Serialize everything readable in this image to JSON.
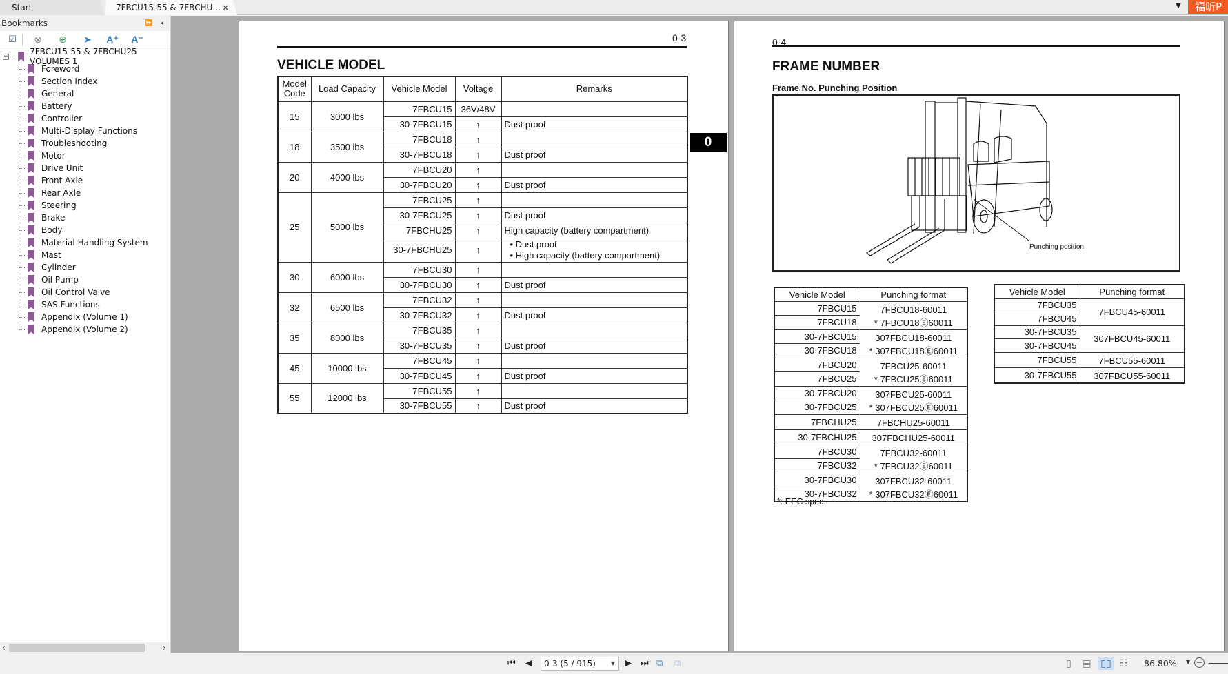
{
  "tabs": [
    {
      "label": "Start"
    },
    {
      "label": "7FBCU15-55 & 7FBCHU...",
      "close": "×"
    }
  ],
  "brand_button": "福昕P",
  "sidebar": {
    "title": "Bookmarks",
    "header_buttons": [
      "⏩",
      "◂"
    ],
    "toolbar": [
      {
        "name": "expand-bookmark",
        "glyph": "☑"
      },
      {
        "name": "delete-bookmark",
        "glyph": "⊗"
      },
      {
        "name": "add-bookmark",
        "glyph": "⊕"
      },
      {
        "name": "goto-bookmark",
        "glyph": "➤"
      },
      {
        "name": "increase-font",
        "glyph": "A⁺"
      },
      {
        "name": "decrease-font",
        "glyph": "A⁻"
      }
    ],
    "root": {
      "label": "7FBCU15-55 & 7FBCHU25 VOLUMES 1",
      "expander": "−"
    },
    "items": [
      "Foreword",
      "Section Index",
      "General",
      "Battery",
      "Controller",
      "Multi-Display Functions",
      "Troubleshooting",
      "Motor",
      "Drive Unit",
      "Front Axle",
      "Rear Axle",
      "Steering",
      "Brake",
      "Body",
      "Material Handling System",
      "Mast",
      "Cylinder",
      "Oil Pump",
      "Oil Control Valve",
      "SAS Functions",
      "Appendix (Volume 1)",
      "Appendix (Volume 2)"
    ],
    "scroll_left": "‹",
    "scroll_right": "›"
  },
  "left_page": {
    "page_number": "0-3",
    "title": "VEHICLE MODEL",
    "section_tab": "0",
    "table": {
      "headers": [
        "Model Code",
        "Load Capacity",
        "Vehicle Model",
        "Voltage",
        "Remarks"
      ],
      "groups": [
        {
          "code": "15",
          "load": "3000 lbs",
          "rows": [
            {
              "model": "7FBCU15",
              "voltage": "36V/48V",
              "remarks": []
            },
            {
              "model": "30-7FBCU15",
              "voltage": "↑",
              "remarks": [
                "Dust proof"
              ]
            }
          ]
        },
        {
          "code": "18",
          "load": "3500 lbs",
          "rows": [
            {
              "model": "7FBCU18",
              "voltage": "↑",
              "remarks": []
            },
            {
              "model": "30-7FBCU18",
              "voltage": "↑",
              "remarks": [
                "Dust proof"
              ]
            }
          ]
        },
        {
          "code": "20",
          "load": "4000 lbs",
          "rows": [
            {
              "model": "7FBCU20",
              "voltage": "↑",
              "remarks": []
            },
            {
              "model": "30-7FBCU20",
              "voltage": "↑",
              "remarks": [
                "Dust proof"
              ]
            }
          ]
        },
        {
          "code": "25",
          "load": "5000 lbs",
          "rows": [
            {
              "model": "7FBCU25",
              "voltage": "↑",
              "remarks": []
            },
            {
              "model": "30-7FBCU25",
              "voltage": "↑",
              "remarks": [
                "Dust proof"
              ]
            },
            {
              "model": "7FBCHU25",
              "voltage": "↑",
              "remarks": [
                "High capacity (battery compartment)"
              ]
            },
            {
              "model": "30-7FBCHU25",
              "voltage": "↑",
              "remarks": [
                "Dust proof",
                "High capacity (battery compartment)"
              ],
              "bulleted": true
            }
          ]
        },
        {
          "code": "30",
          "load": "6000 lbs",
          "rows": [
            {
              "model": "7FBCU30",
              "voltage": "↑",
              "remarks": []
            },
            {
              "model": "30-7FBCU30",
              "voltage": "↑",
              "remarks": [
                "Dust proof"
              ]
            }
          ]
        },
        {
          "code": "32",
          "load": "6500 lbs",
          "rows": [
            {
              "model": "7FBCU32",
              "voltage": "↑",
              "remarks": []
            },
            {
              "model": "30-7FBCU32",
              "voltage": "↑",
              "remarks": [
                "Dust proof"
              ]
            }
          ]
        },
        {
          "code": "35",
          "load": "8000 lbs",
          "rows": [
            {
              "model": "7FBCU35",
              "voltage": "↑",
              "remarks": []
            },
            {
              "model": "30-7FBCU35",
              "voltage": "↑",
              "remarks": [
                "Dust proof"
              ]
            }
          ]
        },
        {
          "code": "45",
          "load": "10000 lbs",
          "rows": [
            {
              "model": "7FBCU45",
              "voltage": "↑",
              "remarks": []
            },
            {
              "model": "30-7FBCU45",
              "voltage": "↑",
              "remarks": [
                "Dust proof"
              ]
            }
          ]
        },
        {
          "code": "55",
          "load": "12000 lbs",
          "rows": [
            {
              "model": "7FBCU55",
              "voltage": "↑",
              "remarks": []
            },
            {
              "model": "30-7FBCU55",
              "voltage": "↑",
              "remarks": [
                "Dust proof"
              ]
            }
          ]
        }
      ]
    }
  },
  "right_page": {
    "page_number": "0-4",
    "title": "FRAME NUMBER",
    "subtitle": "Frame No. Punching Position",
    "figure_label": "Punching position",
    "table1": {
      "headers": [
        "Vehicle Model",
        "Punching format"
      ],
      "groups": [
        {
          "models": [
            "7FBCU15",
            "7FBCU18"
          ],
          "formats": [
            "7FBCU18-60011",
            "* 7FBCU18Ⓔ60011"
          ]
        },
        {
          "models": [
            "30-7FBCU15",
            "30-7FBCU18"
          ],
          "formats": [
            "307FBCU18-60011",
            "* 307FBCU18Ⓔ60011"
          ]
        },
        {
          "models": [
            "7FBCU20",
            "7FBCU25"
          ],
          "formats": [
            "7FBCU25-60011",
            "* 7FBCU25Ⓔ60011"
          ]
        },
        {
          "models": [
            "30-7FBCU20",
            "30-7FBCU25"
          ],
          "formats": [
            "307FBCU25-60011",
            "* 307FBCU25Ⓔ60011"
          ]
        },
        {
          "models": [
            "7FBCHU25"
          ],
          "formats": [
            "7FBCHU25-60011"
          ]
        },
        {
          "models": [
            "30-7FBCHU25"
          ],
          "formats": [
            "307FBCHU25-60011"
          ]
        },
        {
          "models": [
            "7FBCU30",
            "7FBCU32"
          ],
          "formats": [
            "7FBCU32-60011",
            "* 7FBCU32Ⓔ60011"
          ]
        },
        {
          "models": [
            "30-7FBCU30",
            "30-7FBCU32"
          ],
          "formats": [
            "307FBCU32-60011",
            "* 307FBCU32Ⓔ60011"
          ]
        }
      ]
    },
    "table2": {
      "headers": [
        "Vehicle Model",
        "Punching format"
      ],
      "groups": [
        {
          "models": [
            "7FBCU35",
            "7FBCU45"
          ],
          "formats": [
            "7FBCU45-60011"
          ]
        },
        {
          "models": [
            "30-7FBCU35",
            "30-7FBCU45"
          ],
          "formats": [
            "307FBCU45-60011"
          ]
        },
        {
          "models": [
            "7FBCU55"
          ],
          "formats": [
            "7FBCU55-60011"
          ]
        },
        {
          "models": [
            "30-7FBCU55"
          ],
          "formats": [
            "307FBCU55-60011"
          ]
        }
      ]
    },
    "footnote": "*: EEC spec."
  },
  "statusbar": {
    "first_page": "⏮",
    "prev_page": "◀",
    "page_display": "0-3 (5 / 915)",
    "next_page": "▶",
    "last_page": "⏭",
    "view_modes": [
      "single-page",
      "continuous",
      "facing",
      "continuous-facing"
    ],
    "active_view": "facing",
    "zoom": "86.80%",
    "zoom_out": "−"
  }
}
